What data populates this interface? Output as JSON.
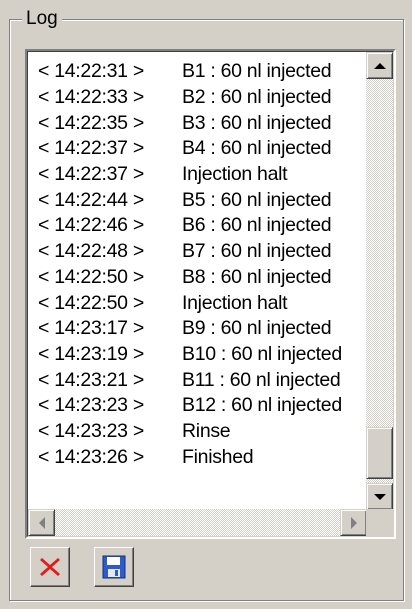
{
  "log": {
    "title": "Log",
    "entries": [
      {
        "time": "< 14:22:31 >",
        "message": "B1 : 60 nl injected"
      },
      {
        "time": "< 14:22:33 >",
        "message": "B2 : 60 nl injected"
      },
      {
        "time": "< 14:22:35 >",
        "message": "B3 : 60 nl injected"
      },
      {
        "time": "< 14:22:37 >",
        "message": "B4 : 60 nl injected"
      },
      {
        "time": "< 14:22:37 >",
        "message": "Injection halt"
      },
      {
        "time": "< 14:22:44 >",
        "message": "B5 : 60 nl injected"
      },
      {
        "time": "< 14:22:46 >",
        "message": "B6 : 60 nl injected"
      },
      {
        "time": "< 14:22:48 >",
        "message": "B7 : 60 nl injected"
      },
      {
        "time": "< 14:22:50 >",
        "message": "B8 : 60 nl injected"
      },
      {
        "time": "< 14:22:50 >",
        "message": "Injection halt"
      },
      {
        "time": "< 14:23:17 >",
        "message": "B9 : 60 nl injected"
      },
      {
        "time": "< 14:23:19 >",
        "message": "B10 : 60 nl injected"
      },
      {
        "time": "< 14:23:21 >",
        "message": "B11 : 60 nl injected"
      },
      {
        "time": "< 14:23:23 >",
        "message": "B12 : 60 nl injected"
      },
      {
        "time": "< 14:23:23 >",
        "message": "Rinse"
      },
      {
        "time": "< 14:23:26 >",
        "message": "Finished"
      }
    ]
  },
  "toolbar": {
    "clear_icon": "red-x-icon",
    "save_icon": "floppy-disk-icon",
    "clear_color": "#e21b1b",
    "save_color": "#2d5bc7"
  }
}
